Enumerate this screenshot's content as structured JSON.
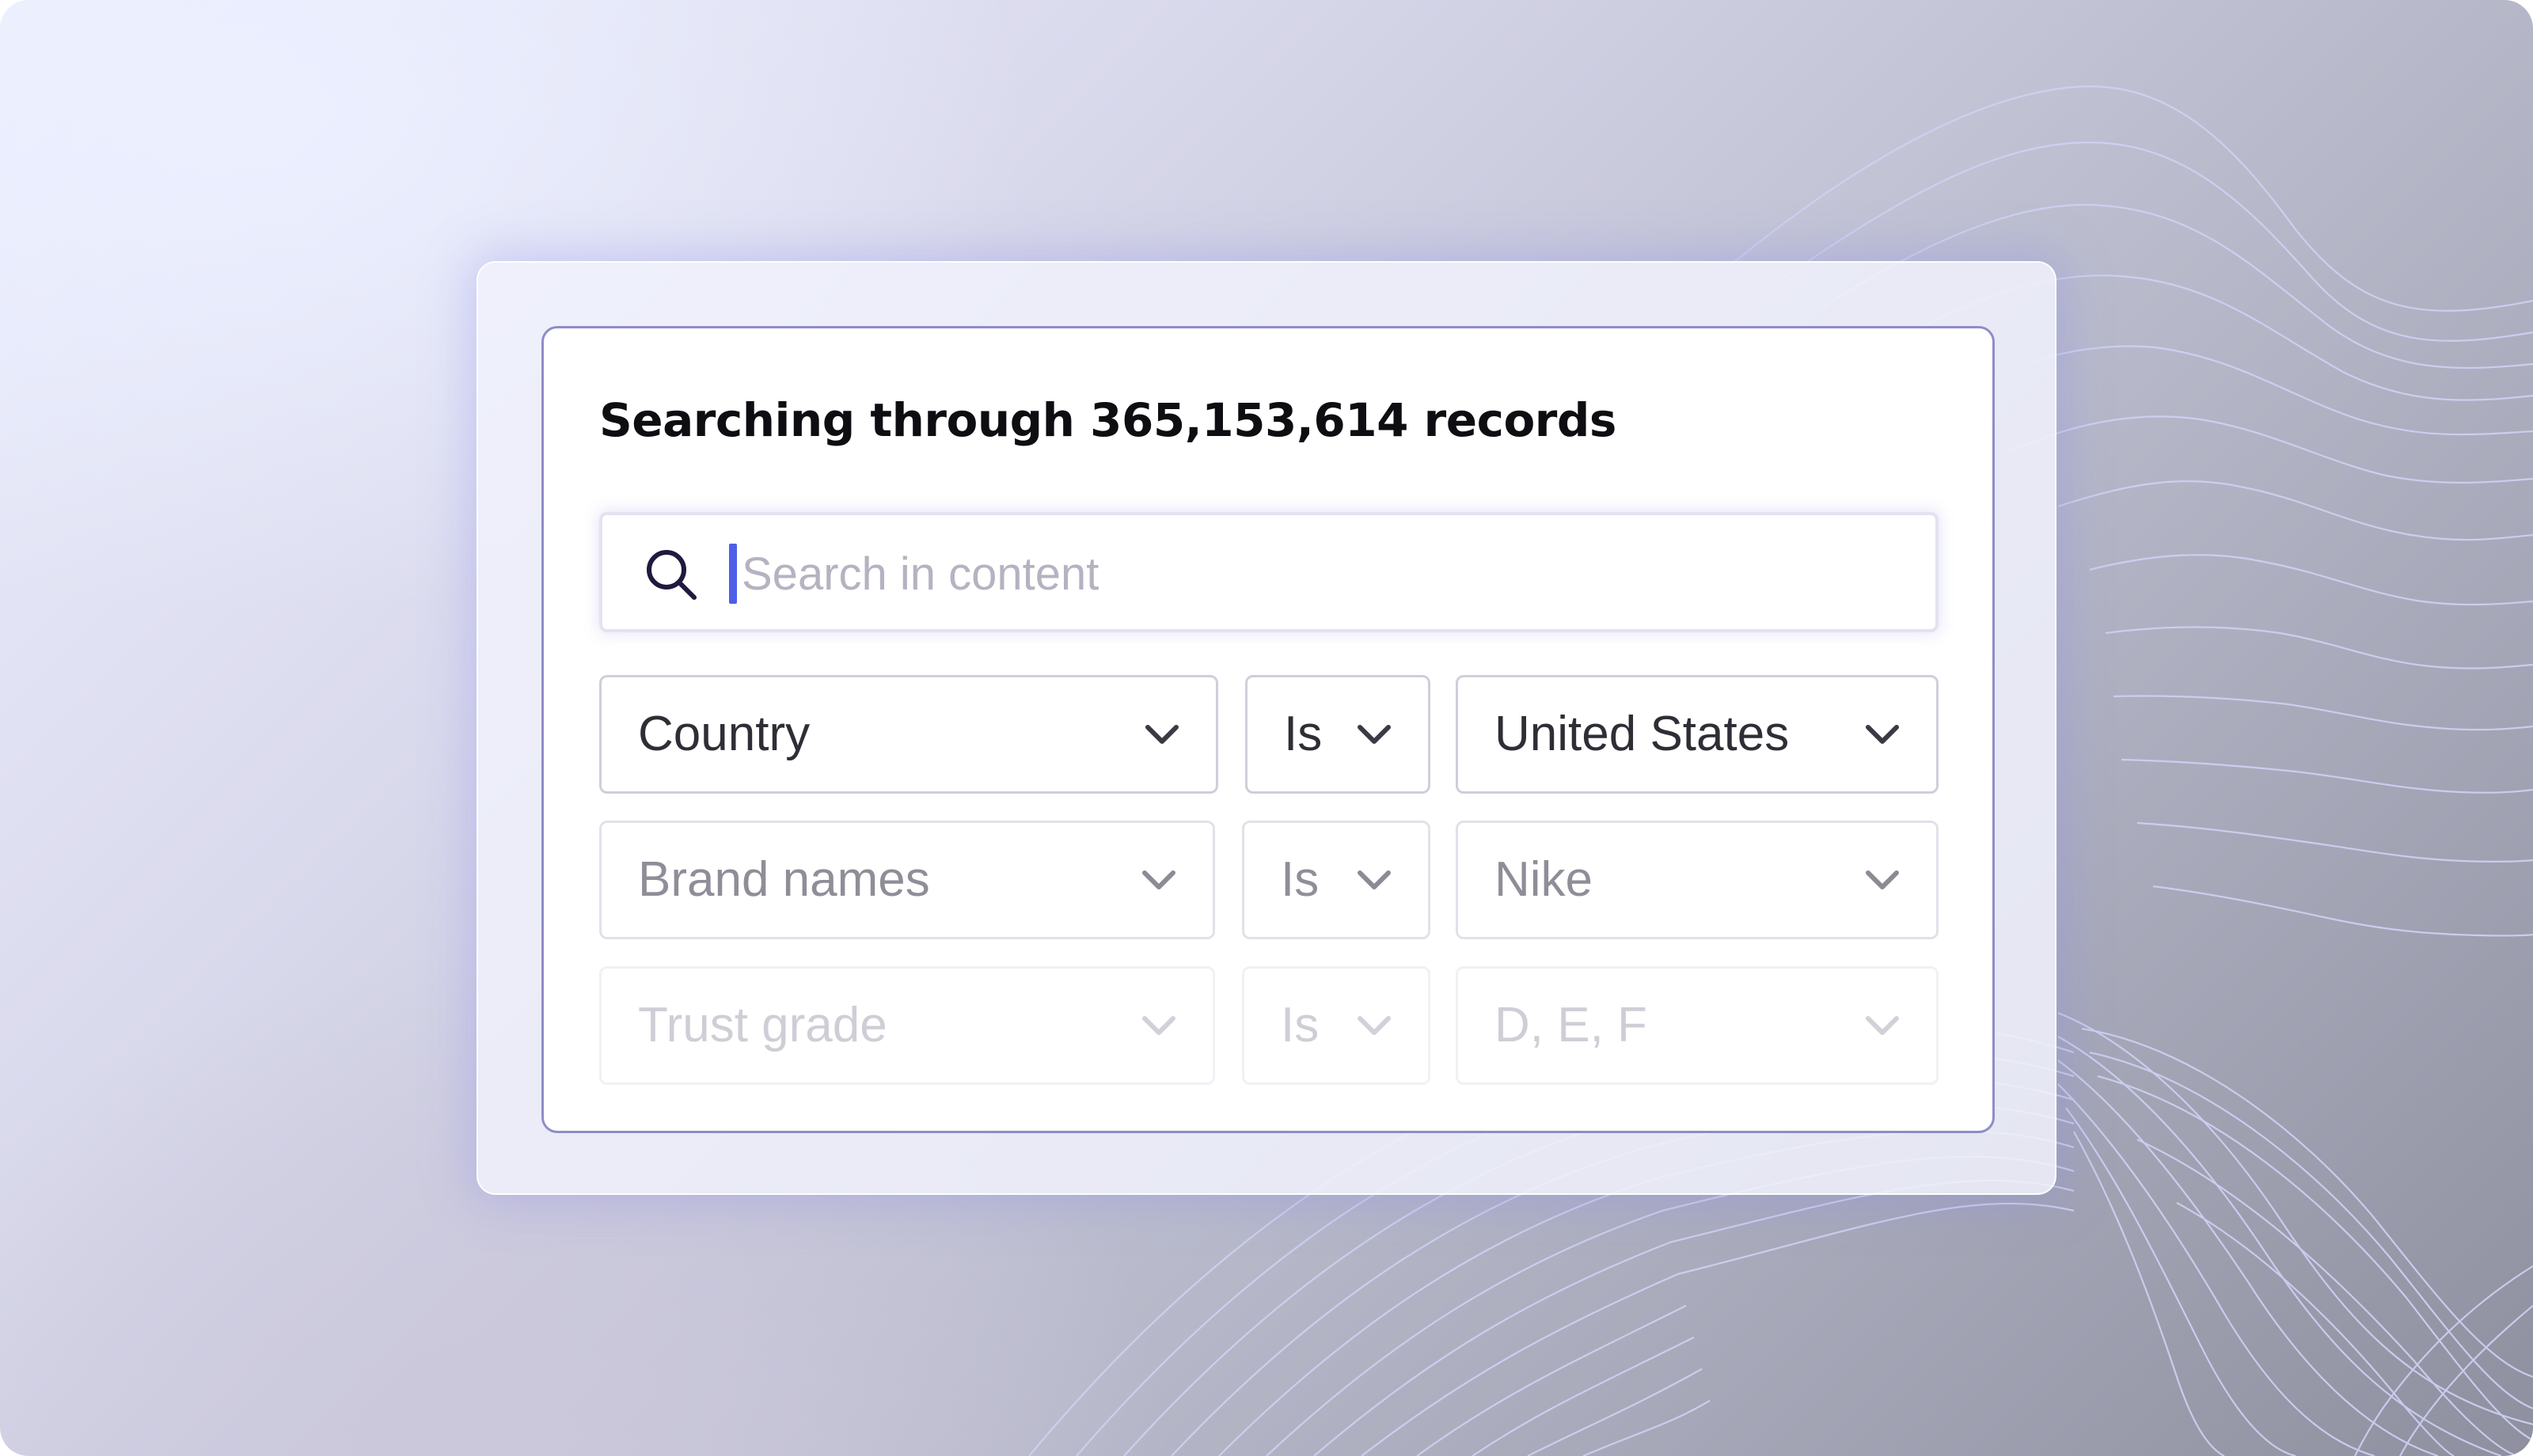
{
  "panel": {
    "title": "Searching through 365,153,614 records"
  },
  "search": {
    "placeholder": "Search in content",
    "value": ""
  },
  "filters": [
    {
      "field": "Country",
      "operator": "Is",
      "value": "United States"
    },
    {
      "field": "Brand names",
      "operator": "Is",
      "value": "Nike"
    },
    {
      "field": "Trust grade",
      "operator": "Is",
      "value": "D, E, F"
    }
  ],
  "icons": {
    "search": "search-icon",
    "dropdown": "chevron-down-icon"
  },
  "colors": {
    "accent": "#4d5ee8",
    "panel_border": "#8f8cc9",
    "wave_lines": "#c9ccf2"
  }
}
